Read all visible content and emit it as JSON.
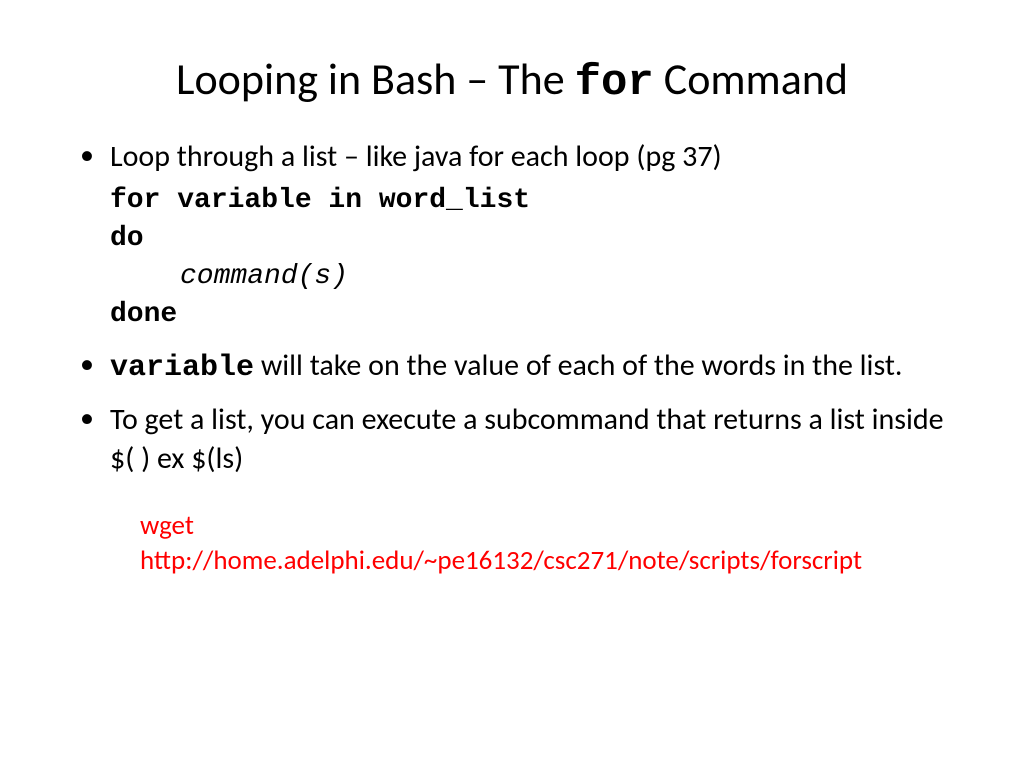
{
  "title": {
    "pre": "Looping in Bash – The ",
    "mono": "for",
    "post": " Command"
  },
  "bullet1": {
    "text": "Loop through a list – like java for each loop  (pg 37)",
    "code": {
      "l1": "for variable in word_list",
      "l2": "do",
      "l3": "command(s)",
      "l4": "done"
    }
  },
  "bullet2": {
    "mono": "variable",
    "rest": " will take on the value of each of the words in the list."
  },
  "bullet3": {
    "text": "To get a list, you can execute a subcommand  that returns a list inside $(    )  ex  $(ls)"
  },
  "footer": {
    "l1": "wget",
    "l2": "http://home.adelphi.edu/~pe16132/csc271/note/scripts/forscript"
  }
}
